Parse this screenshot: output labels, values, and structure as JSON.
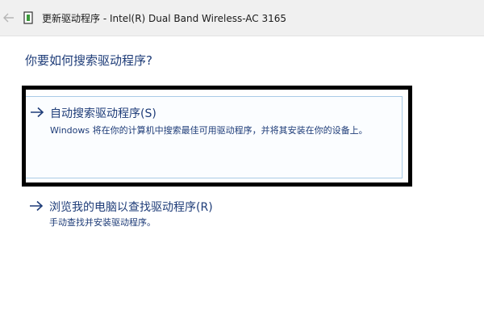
{
  "window": {
    "title": "更新驱动程序 - Intel(R) Dual Band Wireless-AC 3165"
  },
  "question": "你要如何搜索驱动程序?",
  "options": [
    {
      "label": "自动搜索驱动程序(S)",
      "description": "Windows 将在你的计算机中搜索最佳可用驱动程序，并将其安装在你的设备上。"
    },
    {
      "label": "浏览我的电脑以查找驱动程序(R)",
      "description": "手动查找并安装驱动程序。"
    }
  ],
  "icons": {
    "back": "back-arrow-icon",
    "device": "device-icon",
    "option_arrow": "right-arrow-icon"
  },
  "colors": {
    "link_text": "#1e3c78",
    "option_border": "#a9cbe6",
    "highlight_frame": "#000000",
    "titlebar_bg": "#f0f0f0"
  }
}
